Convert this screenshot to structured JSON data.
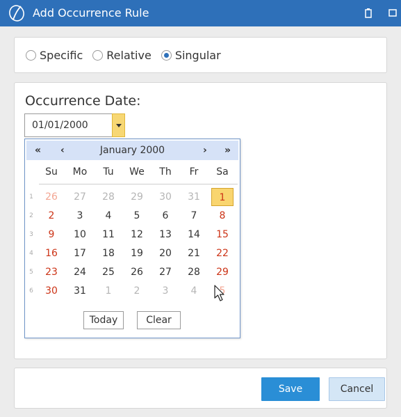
{
  "window": {
    "title": "Add Occurrence Rule"
  },
  "occurrence_type": {
    "options": [
      "Specific",
      "Relative",
      "Singular"
    ],
    "selected": "Singular"
  },
  "date_field": {
    "label": "Occurrence Date:",
    "value": "01/01/2000"
  },
  "calendar": {
    "title": "January 2000",
    "nav": {
      "fast_prev": "«",
      "prev": "‹",
      "next": "›",
      "fast_next": "»"
    },
    "weekday_headers": [
      "Su",
      "Mo",
      "Tu",
      "We",
      "Th",
      "Fr",
      "Sa"
    ],
    "week_numbers": [
      "1",
      "2",
      "3",
      "4",
      "5",
      "6"
    ],
    "weeks": [
      [
        "26",
        "27",
        "28",
        "29",
        "30",
        "31",
        "1"
      ],
      [
        "2",
        "3",
        "4",
        "5",
        "6",
        "7",
        "8"
      ],
      [
        "9",
        "10",
        "11",
        "12",
        "13",
        "14",
        "15"
      ],
      [
        "16",
        "17",
        "18",
        "19",
        "20",
        "21",
        "22"
      ],
      [
        "23",
        "24",
        "25",
        "26",
        "27",
        "28",
        "29"
      ],
      [
        "30",
        "31",
        "1",
        "2",
        "3",
        "4",
        "5"
      ]
    ],
    "selected_day": "1",
    "today_label": "Today",
    "clear_label": "Clear"
  },
  "footer": {
    "save_label": "Save",
    "cancel_label": "Cancel"
  }
}
